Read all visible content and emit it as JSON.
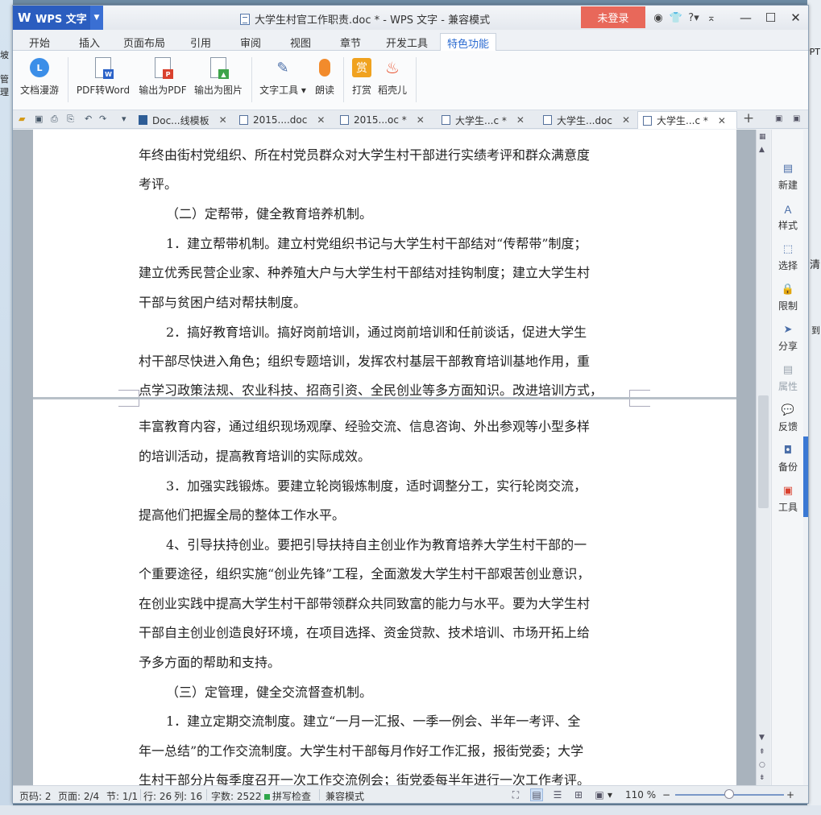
{
  "desktop": {
    "left_fragments": [
      "坡",
      "管理"
    ],
    "right_fragments": [
      "PPT",
      "清",
      "到"
    ]
  },
  "titlebar": {
    "app_name": "WPS 文字",
    "document_title": "大学生村官工作职责.doc * - WPS 文字 - 兼容模式",
    "login_label": "未登录",
    "help_label": "?"
  },
  "menu": {
    "tabs": [
      "开始",
      "插入",
      "页面布局",
      "引用",
      "审阅",
      "视图",
      "章节",
      "开发工具",
      "特色功能"
    ],
    "active": "特色功能"
  },
  "ribbon": {
    "doc_roam": "文档漫游",
    "pdf_to_word": "PDF转Word",
    "export_pdf": "输出为PDF",
    "export_image": "输出为图片",
    "text_tools": "文字工具",
    "read_aloud": "朗读",
    "reward": "打赏",
    "docer": "稻壳儿",
    "reward_glyph": "赏",
    "cloud_glyph": "L"
  },
  "doc_tabs": [
    {
      "label": "Doc...线模板"
    },
    {
      "label": "2015....doc"
    },
    {
      "label": "2015...oc *"
    },
    {
      "label": "大学生...c *"
    },
    {
      "label": "大学生...doc"
    },
    {
      "label": "大学生...c *"
    }
  ],
  "document": {
    "page1_lines": [
      "年终由街村党组织、所在村党员群众对大学生村干部进行实绩考评和群众满意度",
      "考评。",
      "（二）定帮带，健全教育培养机制。",
      "1．建立帮带机制。建立村党组织书记与大学生村干部结对“传帮带”制度；",
      "建立优秀民营企业家、种养殖大户与大学生村干部结对挂钩制度；建立大学生村",
      "干部与贫困户结对帮扶制度。",
      "2．搞好教育培训。搞好岗前培训，通过岗前培训和任前谈话，促进大学生",
      "村干部尽快进入角色；组织专题培训，发挥农村基层干部教育培训基地作用，重",
      "点学习政策法规、农业科技、招商引资、全民创业等多方面知识。改进培训方式，"
    ],
    "page2_lines": [
      "丰富教育内容，通过组织现场观摩、经验交流、信息咨询、外出参观等小型多样",
      "的培训活动，提高教育培训的实际成效。",
      "3．加强实践锻炼。要建立轮岗锻炼制度，适时调整分工，实行轮岗交流，",
      "提高他们把握全局的整体工作水平。",
      "4、引导扶持创业。要把引导扶持自主创业作为教育培养大学生村干部的一",
      "个重要途径，组织实施“创业先锋”工程，全面激发大学生村干部艰苦创业意识，",
      "在创业实践中提高大学生村干部带领群众共同致富的能力与水平。要为大学生村",
      "干部自主创业创造良好环境，在项目选择、资金贷款、技术培训、市场开拓上给",
      "予多方面的帮助和支持。",
      "（三）定管理，健全交流督查机制。",
      "1．建立定期交流制度。建立“一月一汇报、一季一例会、半年一考评、全",
      "年一总结”的工作交流制度。大学生村干部每月作好工作汇报，报街党委；大学",
      "生村干部分片每季度召开一次工作交流例会；街党委每半年进行一次工作考评。"
    ]
  },
  "sidebar": {
    "new": "新建",
    "style": "样式",
    "select": "选择",
    "restrict": "限制",
    "share": "分享",
    "properties": "属性",
    "feedback": "反馈",
    "backup": "备份",
    "tools": "工具"
  },
  "statusbar": {
    "page_no": "页码: 2",
    "pages": "页面: 2/4",
    "section": "节: 1/1",
    "row": "行: 26",
    "column": "列: 16",
    "word_count": "字数: 2522",
    "spell_check": "拼写检查",
    "compat_mode": "兼容模式",
    "zoom": "110 %"
  },
  "colors": {
    "app_blue": "#2b5dbf",
    "login_red": "#e8685a",
    "active_tab_text": "#2b6bd1"
  }
}
